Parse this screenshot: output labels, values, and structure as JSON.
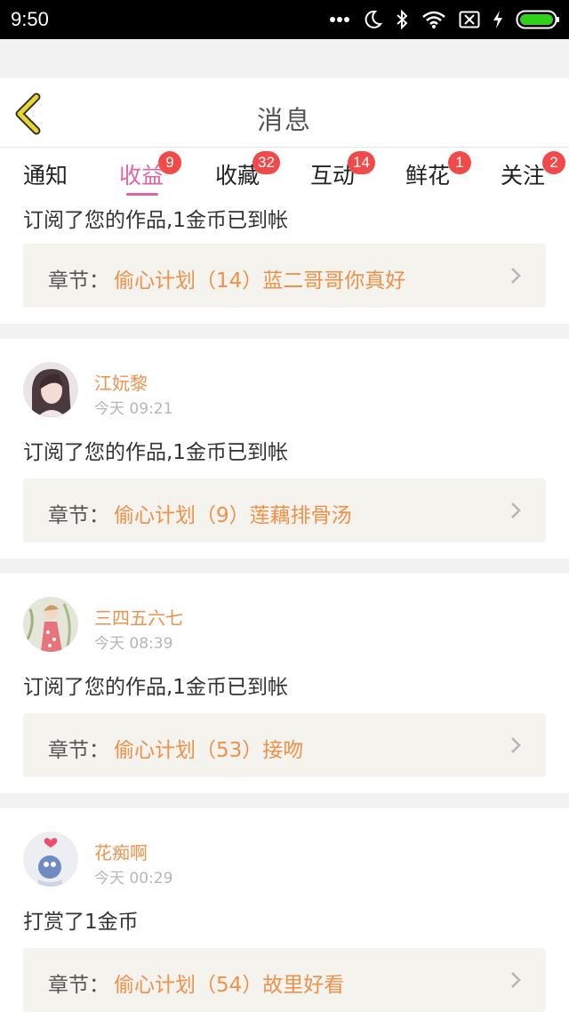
{
  "status_bar": {
    "time": "9:50",
    "icons": [
      "more-dots-icon",
      "moon-icon",
      "bluetooth-icon",
      "wifi-icon",
      "sim-x-icon",
      "charging-icon",
      "battery-icon"
    ],
    "battery_color": "#33d11f"
  },
  "header": {
    "title": "消息",
    "back_icon": "chevron-left-icon",
    "back_color": "#e9d531"
  },
  "tabs": [
    {
      "label": "通知",
      "badge": null,
      "active": false
    },
    {
      "label": "收益",
      "badge": "9",
      "active": true
    },
    {
      "label": "收藏",
      "badge": "32",
      "active": false
    },
    {
      "label": "互动",
      "badge": "14",
      "active": false
    },
    {
      "label": "鲜花",
      "badge": "1",
      "active": false
    },
    {
      "label": "关注",
      "badge": "2",
      "active": false
    }
  ],
  "accent_color": "#e0649f",
  "badge_color": "#f04a4a",
  "name_color": "#f0914a",
  "feed": [
    {
      "name": null,
      "time": null,
      "message": "订阅了您的作品,1金币已到帐",
      "chapter_label": "章节：",
      "chapter_title": "偷心计划（14）蓝二哥哥你真好"
    },
    {
      "name": "江妧黎",
      "time": "今天 09:21",
      "message": "订阅了您的作品,1金币已到帐",
      "chapter_label": "章节：",
      "chapter_title": "偷心计划（9）莲藕排骨汤"
    },
    {
      "name": "三四五六七",
      "time": "今天 08:39",
      "message": "订阅了您的作品,1金币已到帐",
      "chapter_label": "章节：",
      "chapter_title": "偷心计划（53）接吻"
    },
    {
      "name": "花痴啊",
      "time": "今天 00:29",
      "message": "打赏了1金币",
      "chapter_label": "章节：",
      "chapter_title": "偷心计划（54）故里好看"
    }
  ]
}
